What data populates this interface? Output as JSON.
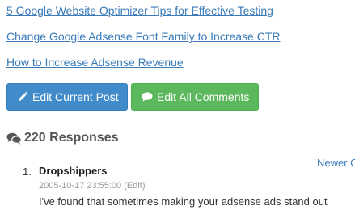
{
  "related_posts": [
    "5 Google Website Optimizer Tips for Effective Testing",
    "Change Google Adsense Font Family to Increase CTR",
    "How to Increase Adsense Revenue"
  ],
  "buttons": {
    "edit_post": "Edit Current Post",
    "edit_comments": "Edit All Comments"
  },
  "responses": {
    "count_label": "220 Responses",
    "newer_link": "Newer C"
  },
  "comment": {
    "number": "1.",
    "author": "Dropshippers",
    "timestamp": "2005-10-17 23:55:00",
    "edit_label": "(Edit)",
    "text": "I've found that sometimes making your adsense ads stand out"
  },
  "icons": {
    "edit_post": "pencil-icon",
    "edit_comments": "comment-bubble-icon",
    "responses": "comments-icon"
  },
  "colors": {
    "link": "#3a7bb8",
    "primary": "#428bca",
    "success": "#5cb85c"
  }
}
